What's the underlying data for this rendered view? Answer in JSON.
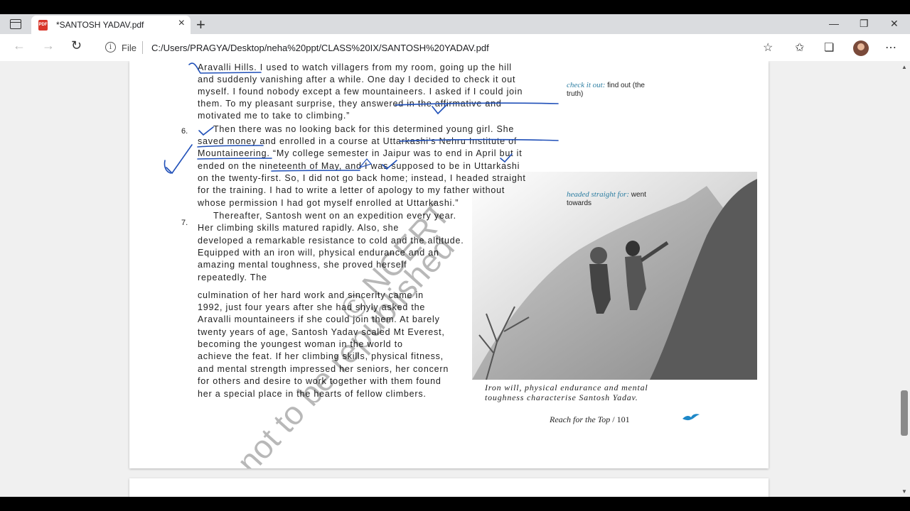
{
  "browser": {
    "tab_title": "*SANTOSH YADAV.pdf",
    "tab_icon_text": "PDF",
    "address_label": "File",
    "url": "C:/Users/PRAGYA/Desktop/neha%20ppt/CLASS%20IX/SANTOSH%20YADAV.pdf"
  },
  "pdf": {
    "lines": [
      "Aravalli Hills. I used to watch villagers from my  room, going up the hill",
      "and suddenly vanishing after  a while. One day I decided to check it out",
      "myself. I  found nobody except  a few  mountaineers. I asked if  I could join",
      "them. To my pleasant surprise, they  answered in the affirmative and",
      "motivated me to take to climbing.”",
      "Then there was no looking back for this  determined young girl. She",
      "saved money and enrolled  in a course at Uttarkashi’s Nehru Institute of",
      "Mountaineering. “My college semester in Jaipur was  to end in April but it",
      "ended on the nineteenth of  May, and I was supposed to be  in Uttarkashi",
      "on  the twenty-first. So, I did not go back home; instead,  I headed straight",
      "for the training. I had to write a  letter of apology to my father without",
      "whose  permission I had got myself enrolled at Uttarkashi.”",
      "Thereafter, Santosh went on an  expedition every year.",
      "Her  climbing    skills  matured  rapidly.  Also,  she",
      "developed a remarkable resistance to  cold and the altitude.",
      "Equipped with  an iron will, physical endurance and   an",
      "amazing  mental  toughness,  she    proved   herself",
      "repeatedly.  The",
      "culmination of her hard work and  sincerity came in",
      "1992, just four years  after she had shyly asked the",
      "Aravalli mountaineers if  she could join them.  At barely",
      "twenty years of age, Santosh  Yadav scaled Mt Everest,",
      "becoming  the   youngest  woman  in  the  world  to",
      "achieve the feat. If her climbing skills,  physical fitness,",
      "and mental strength  impressed her seniors, her concern",
      "for  others  and desire to work together with  them found",
      "her a special place in the  hearts of fellow  climbers."
    ],
    "para_numbers": [
      "6.",
      "7."
    ],
    "glossary": [
      {
        "term": "check it out:",
        "def_line1": "find out (the",
        "def_line2": "truth)"
      },
      {
        "term": "headed straight for:",
        "def_line1": "went",
        "def_line2": "towards"
      }
    ],
    "caption_line1": "Iron  will,  physical  endurance  and    mental",
    "caption_line2": "toughness  characterise  Santosh  Yadav.",
    "footer_title": "Reach for the Top",
    "footer_sep": "/",
    "page_number": "101",
    "watermark_line1": "© NCERT",
    "watermark_line2": "not to be republished"
  },
  "colors": {
    "ink_pen": "#1f4fb8",
    "glossary_term": "#2d7ea2"
  }
}
